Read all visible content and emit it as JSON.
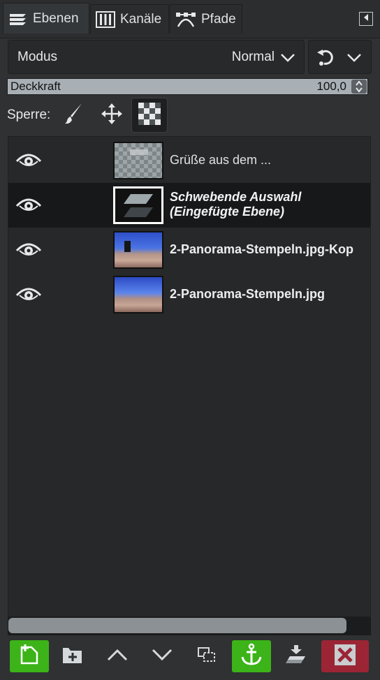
{
  "tabs": [
    {
      "label": "Ebenen",
      "icon": "layers-icon",
      "active": true
    },
    {
      "label": "Kanäle",
      "icon": "channels-icon",
      "active": false
    },
    {
      "label": "Pfade",
      "icon": "paths-icon",
      "active": false
    }
  ],
  "mode": {
    "label": "Modus",
    "value": "Normal"
  },
  "opacity": {
    "label": "Deckkraft",
    "value": "100,0"
  },
  "lock": {
    "label": "Sperre:",
    "items": [
      "paintbrush-icon",
      "move-icon",
      "checkerboard-icon"
    ]
  },
  "layers": [
    {
      "name": "Grüße aus dem ...",
      "visible": true,
      "style": "normal",
      "thumbnail": "transparent-text"
    },
    {
      "name_line1": "Schwebende Auswahl",
      "name_line2": "(Eingefügte Ebene)",
      "visible": true,
      "style": "italic-bold",
      "thumbnail": "floating-selection",
      "selected": true
    },
    {
      "name": "2-Panorama-Stempeln.jpg-Kop",
      "visible": true,
      "style": "bold",
      "thumbnail": "panorama-tower"
    },
    {
      "name": "2-Panorama-Stempeln.jpg",
      "visible": true,
      "style": "bold",
      "thumbnail": "panorama"
    }
  ],
  "toolbar": [
    "new-layer-icon",
    "new-group-icon",
    "raise-icon",
    "lower-icon",
    "duplicate-icon",
    "anchor-icon",
    "merge-down-icon",
    "delete-icon"
  ],
  "colors": {
    "background": "#2f3133",
    "selected_row": "#17181a",
    "green_button": "#3cb318",
    "red_button": "#9c2535"
  }
}
